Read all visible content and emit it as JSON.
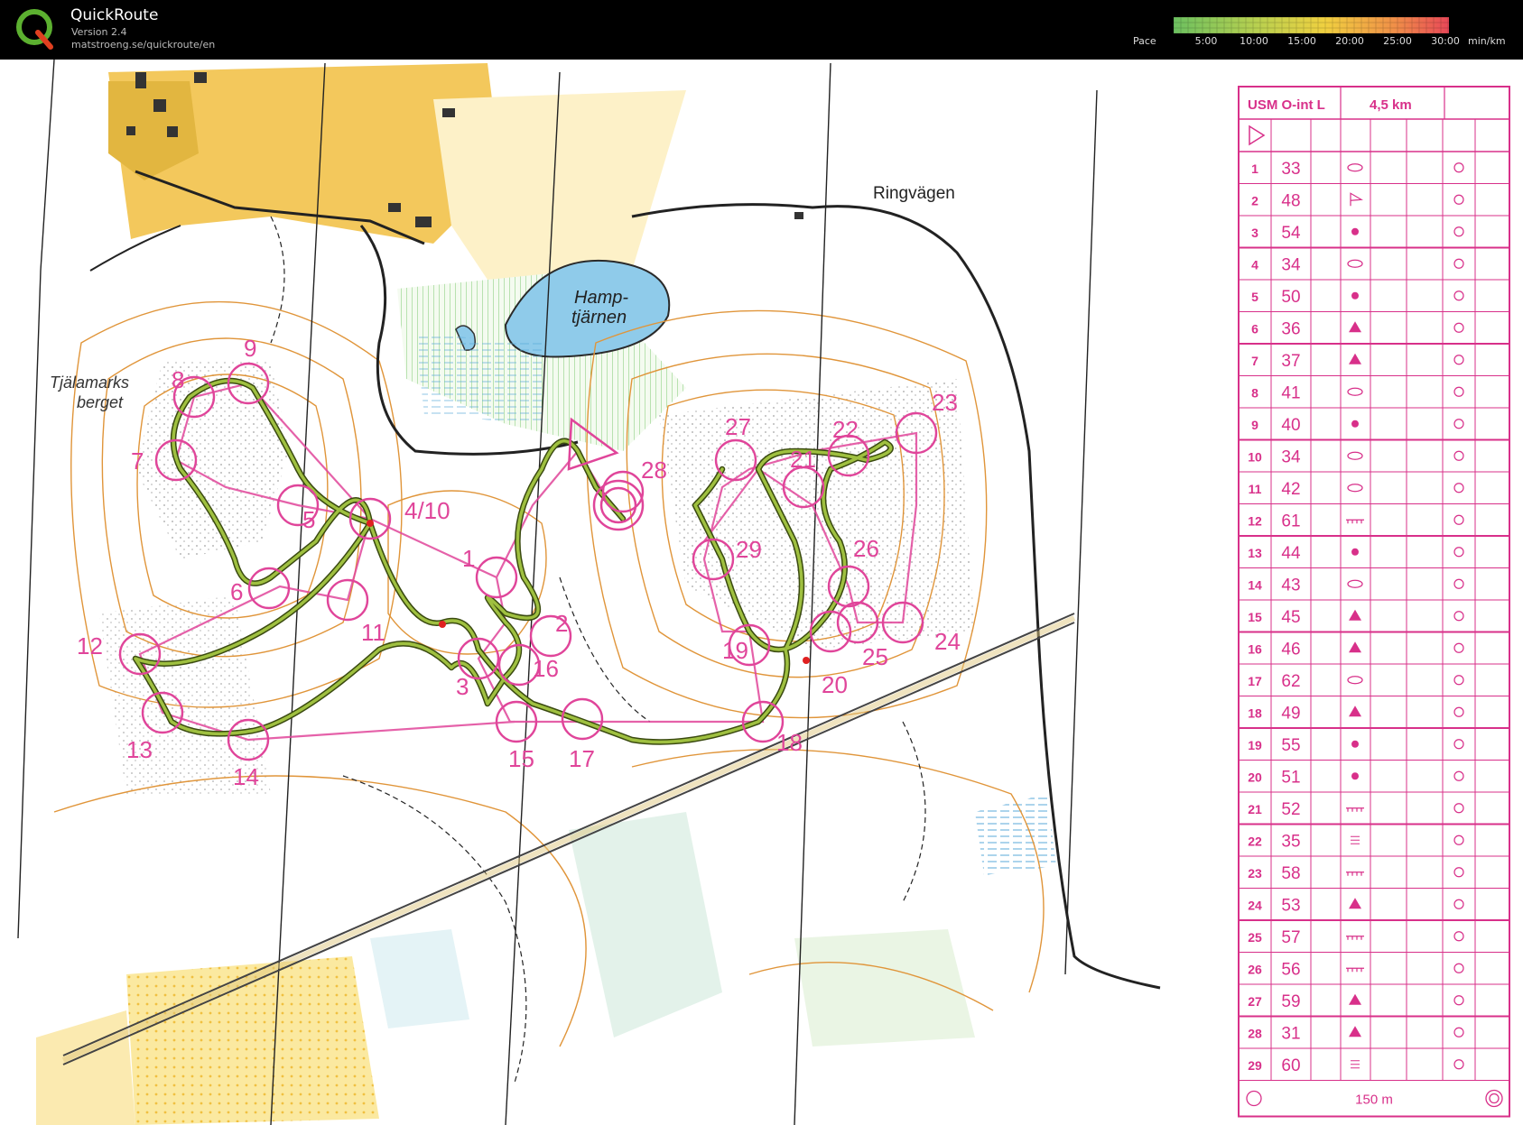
{
  "app": {
    "name": "QuickRoute",
    "version": "Version 2.4",
    "url": "matstroeng.se/quickroute/en"
  },
  "pace": {
    "label": "Pace",
    "ticks": [
      "5:00",
      "10:00",
      "15:00",
      "20:00",
      "25:00",
      "30:00"
    ],
    "unit": "min/km"
  },
  "map": {
    "labels": {
      "ringvagen": "Ringvägen",
      "hamp1": "Hamp-",
      "hamp2": "tjärnen",
      "tjala1": "Tjälamarks",
      "tjala2": "berget"
    },
    "controls": [
      "9",
      "8",
      "7",
      "5",
      "4/10",
      "6",
      "11",
      "12",
      "13",
      "14",
      "1",
      "2",
      "3",
      "16",
      "15",
      "17",
      "18",
      "28",
      "29",
      "27",
      "22",
      "23",
      "21",
      "26",
      "19",
      "20",
      "25",
      "24"
    ]
  },
  "description_sheet": {
    "title": "USM O-int L",
    "distance": "4,5 km",
    "footer": "150 m",
    "rows": [
      {
        "n": "1",
        "code": "33"
      },
      {
        "n": "2",
        "code": "48"
      },
      {
        "n": "3",
        "code": "54"
      },
      {
        "n": "4",
        "code": "34"
      },
      {
        "n": "5",
        "code": "50"
      },
      {
        "n": "6",
        "code": "36"
      },
      {
        "n": "7",
        "code": "37"
      },
      {
        "n": "8",
        "code": "41"
      },
      {
        "n": "9",
        "code": "40"
      },
      {
        "n": "10",
        "code": "34"
      },
      {
        "n": "11",
        "code": "42"
      },
      {
        "n": "12",
        "code": "61"
      },
      {
        "n": "13",
        "code": "44"
      },
      {
        "n": "14",
        "code": "43"
      },
      {
        "n": "15",
        "code": "45"
      },
      {
        "n": "16",
        "code": "46"
      },
      {
        "n": "17",
        "code": "62"
      },
      {
        "n": "18",
        "code": "49"
      },
      {
        "n": "19",
        "code": "55"
      },
      {
        "n": "20",
        "code": "51"
      },
      {
        "n": "21",
        "code": "52"
      },
      {
        "n": "22",
        "code": "35"
      },
      {
        "n": "23",
        "code": "58"
      },
      {
        "n": "24",
        "code": "53"
      },
      {
        "n": "25",
        "code": "57"
      },
      {
        "n": "26",
        "code": "56"
      },
      {
        "n": "27",
        "code": "59"
      },
      {
        "n": "28",
        "code": "31"
      },
      {
        "n": "29",
        "code": "60"
      }
    ]
  },
  "colors": {
    "course": "#e0459a",
    "route": "#8db030",
    "sheet": "#d8308a"
  }
}
